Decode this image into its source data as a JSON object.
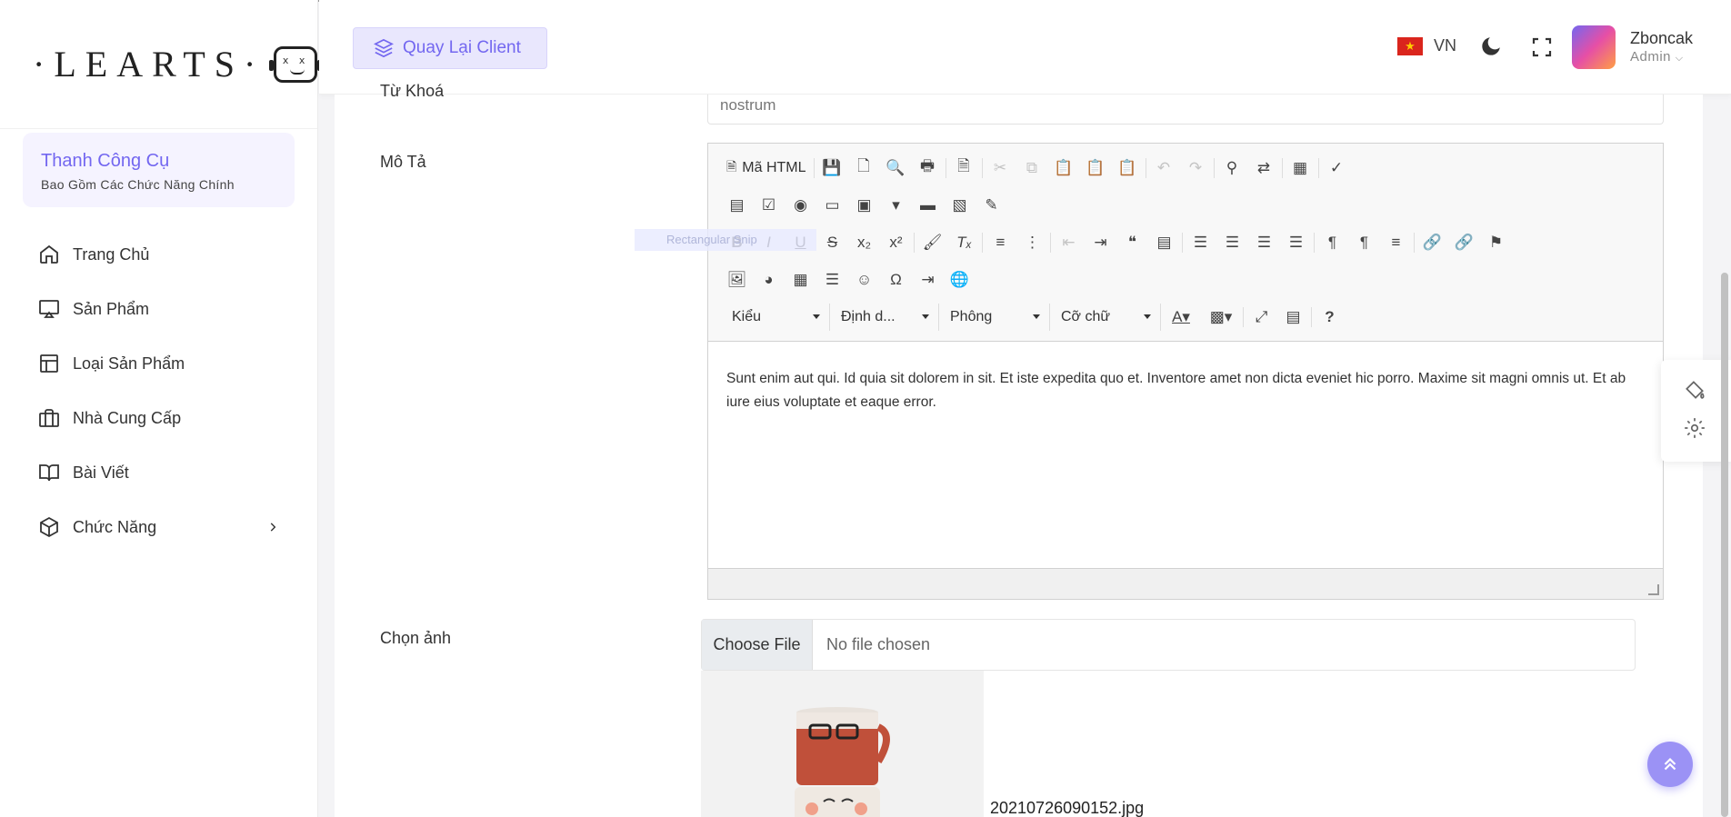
{
  "brand": {
    "logo_text": "·LEARTS·",
    "logo_eyes": "x x"
  },
  "sidebar": {
    "toolbar_title": "Thanh Công Cụ",
    "toolbar_subtitle": "Bao Gồm Các Chức Năng Chính",
    "items": [
      {
        "label": "Trang Chủ",
        "icon": "home-icon"
      },
      {
        "label": "Sản Phẩm",
        "icon": "monitor-icon"
      },
      {
        "label": "Loại Sản Phẩm",
        "icon": "layout-icon"
      },
      {
        "label": "Nhà Cung Cấp",
        "icon": "briefcase-icon"
      },
      {
        "label": "Bài Viết",
        "icon": "book-icon"
      },
      {
        "label": "Chức Năng",
        "icon": "box-icon"
      }
    ]
  },
  "header": {
    "back_label": "Quay Lại Client",
    "lang": "VN",
    "flag_star": "★",
    "user_name": "Zboncak",
    "user_role": "Admin"
  },
  "form": {
    "keyword_label": "Từ Khoá",
    "keyword_value": "nostrum",
    "description_label": "Mô Tả",
    "editor_html_label": "Mã HTML",
    "combo_style": "Kiểu",
    "combo_format": "Định d...",
    "combo_font": "Phông",
    "combo_size": "Cỡ chữ",
    "editor_content": "Sunt enim aut qui. Id quia sit dolorem in sit. Et iste expedita quo et. Inventore amet non dicta eveniet hic porro. Maxime sit magni omnis ut. Et ab iure eius voluptate et eaque error.",
    "ghost_text": "Rectangular Snip",
    "image_label": "Chọn ảnh",
    "choose_file": "Choose File",
    "no_file": "No file chosen",
    "image_filename": "20210726090152.jpg"
  },
  "colors": {
    "accent": "#7367f0",
    "accent_light": "#e9e7fd"
  }
}
